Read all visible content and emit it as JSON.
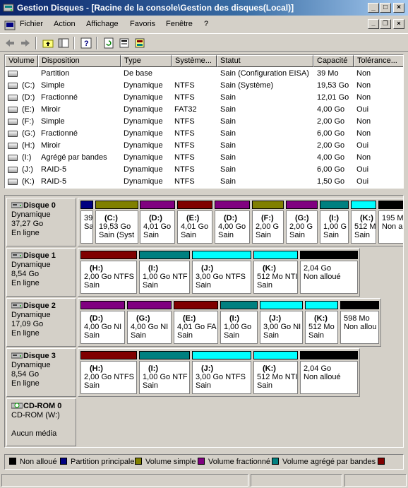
{
  "window": {
    "title": "Gestion Disques - [Racine de la console\\Gestion des disques(Local)]"
  },
  "menu": [
    "Fichier",
    "Action",
    "Affichage",
    "Favoris",
    "Fenêtre",
    "?"
  ],
  "columns": [
    "Volume",
    "Disposition",
    "Type",
    "Système...",
    "Statut",
    "Capacité",
    "Tolérance..."
  ],
  "volumes": [
    [
      "",
      "Partition",
      "De base",
      "",
      "Sain (Configuration EISA)",
      "39 Mo",
      "Non"
    ],
    [
      "(C:)",
      "Simple",
      "Dynamique",
      "NTFS",
      "Sain (Système)",
      "19,53 Go",
      "Non"
    ],
    [
      "(D:)",
      "Fractionné",
      "Dynamique",
      "NTFS",
      "Sain",
      "12,01 Go",
      "Non"
    ],
    [
      "(E:)",
      "Miroir",
      "Dynamique",
      "FAT32",
      "Sain",
      "4,00 Go",
      "Oui"
    ],
    [
      "(F:)",
      "Simple",
      "Dynamique",
      "NTFS",
      "Sain",
      "2,00 Go",
      "Non"
    ],
    [
      "(G:)",
      "Fractionné",
      "Dynamique",
      "NTFS",
      "Sain",
      "6,00 Go",
      "Non"
    ],
    [
      "(H:)",
      "Miroir",
      "Dynamique",
      "NTFS",
      "Sain",
      "2,00 Go",
      "Oui"
    ],
    [
      "(I:)",
      "Agrégé par bandes",
      "Dynamique",
      "NTFS",
      "Sain",
      "4,00 Go",
      "Non"
    ],
    [
      "(J:)",
      "RAID-5",
      "Dynamique",
      "NTFS",
      "Sain",
      "6,00 Go",
      "Oui"
    ],
    [
      "(K:)",
      "RAID-5",
      "Dynamique",
      "NTFS",
      "Sain",
      "1,50 Go",
      "Oui"
    ]
  ],
  "colors": {
    "unallocated": "#000000",
    "primary": "#000080",
    "simple": "#808000",
    "spanned": "#800080",
    "striped": "#008080",
    "mirror": "#800000",
    "raid5": "#00ffff"
  },
  "disks": [
    {
      "name": "Disque 0",
      "type": "Dynamique",
      "size": "37,27 Go",
      "status": "En ligne",
      "partitions": [
        {
          "label": "",
          "size": "39",
          "status": "Sa",
          "kind": "primary"
        },
        {
          "label": "(C:)",
          "size": "19,53 Go",
          "status": "Sain (Syst",
          "kind": "simple"
        },
        {
          "label": "(D:)",
          "size": "4,01 Go",
          "status": "Sain",
          "kind": "spanned"
        },
        {
          "label": "(E:)",
          "size": "4,01 Go",
          "status": "Sain",
          "kind": "mirror"
        },
        {
          "label": "(D:)",
          "size": "4,00 Go",
          "status": "Sain",
          "kind": "spanned"
        },
        {
          "label": "(F:)",
          "size": "2,00 G",
          "status": "Sain",
          "kind": "simple"
        },
        {
          "label": "(G:)",
          "size": "2,00 G",
          "status": "Sain",
          "kind": "spanned"
        },
        {
          "label": "(I:)",
          "size": "1,00 G",
          "status": "Sain",
          "kind": "striped"
        },
        {
          "label": "(K:)",
          "size": "512 M",
          "status": "Sain",
          "kind": "raid5"
        },
        {
          "label": "",
          "size": "195 M",
          "status": "Non a",
          "kind": "unallocated"
        }
      ]
    },
    {
      "name": "Disque 1",
      "type": "Dynamique",
      "size": "8,54 Go",
      "status": "En ligne",
      "partitions": [
        {
          "label": "(H:)",
          "size": "2,00 Go NTFS",
          "status": "Sain",
          "kind": "mirror"
        },
        {
          "label": "(I:)",
          "size": "1,00 Go NTF",
          "status": "Sain",
          "kind": "striped"
        },
        {
          "label": "(J:)",
          "size": "3,00 Go NTFS",
          "status": "Sain",
          "kind": "raid5"
        },
        {
          "label": "(K:)",
          "size": "512 Mo NTI",
          "status": "Sain",
          "kind": "raid5"
        },
        {
          "label": "",
          "size": "2,04 Go",
          "status": "Non alloué",
          "kind": "unallocated"
        }
      ]
    },
    {
      "name": "Disque 2",
      "type": "Dynamique",
      "size": "17,09 Go",
      "status": "En ligne",
      "partitions": [
        {
          "label": "(D:)",
          "size": "4,00 Go NI",
          "status": "Sain",
          "kind": "spanned"
        },
        {
          "label": "(G:)",
          "size": "4,00 Go NI",
          "status": "Sain",
          "kind": "spanned"
        },
        {
          "label": "(E:)",
          "size": "4,01 Go FA",
          "status": "Sain",
          "kind": "mirror"
        },
        {
          "label": "(I:)",
          "size": "1,00 Go",
          "status": "Sain",
          "kind": "striped"
        },
        {
          "label": "(J:)",
          "size": "3,00 Go NI",
          "status": "Sain",
          "kind": "raid5"
        },
        {
          "label": "(K:)",
          "size": "512 Mo",
          "status": "Sain",
          "kind": "raid5"
        },
        {
          "label": "",
          "size": "598 Mo",
          "status": "Non allou",
          "kind": "unallocated"
        }
      ]
    },
    {
      "name": "Disque 3",
      "type": "Dynamique",
      "size": "8,54 Go",
      "status": "En ligne",
      "partitions": [
        {
          "label": "(H:)",
          "size": "2,00 Go NTFS",
          "status": "Sain",
          "kind": "mirror"
        },
        {
          "label": "(I:)",
          "size": "1,00 Go NTF",
          "status": "Sain",
          "kind": "striped"
        },
        {
          "label": "(J:)",
          "size": "3,00 Go NTFS",
          "status": "Sain",
          "kind": "raid5"
        },
        {
          "label": "(K:)",
          "size": "512 Mo NTI",
          "status": "Sain",
          "kind": "raid5"
        },
        {
          "label": "",
          "size": "2,04 Go",
          "status": "Non alloué",
          "kind": "unallocated"
        }
      ]
    }
  ],
  "cdrom": {
    "name": "CD-ROM 0",
    "drive": "CD-ROM (W:)",
    "media": "Aucun média"
  },
  "legend": [
    {
      "label": "Non alloué",
      "kind": "unallocated"
    },
    {
      "label": "Partition principale",
      "kind": "primary"
    },
    {
      "label": "Volume simple",
      "kind": "simple"
    },
    {
      "label": "Volume fractionné",
      "kind": "spanned"
    },
    {
      "label": "Volume agrégé par bandes",
      "kind": "striped"
    },
    {
      "label": "",
      "kind": "mirror"
    }
  ]
}
